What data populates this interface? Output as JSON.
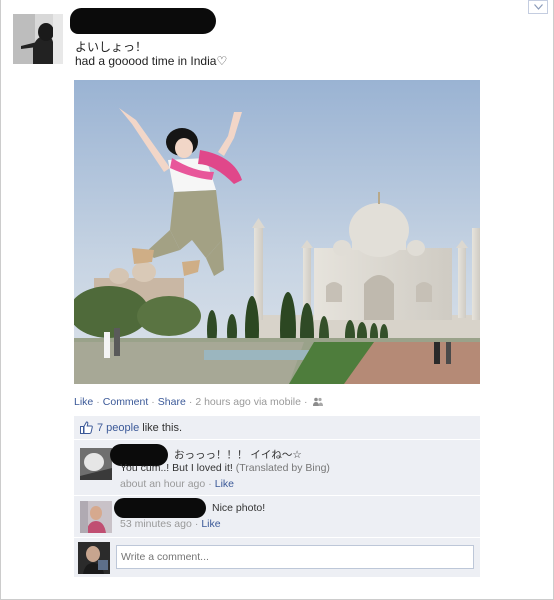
{
  "post": {
    "status_line1": "よいしょっ！",
    "status_line2": "had a gooood time in India♡"
  },
  "actions": {
    "like": "Like",
    "comment": "Comment",
    "share": "Share",
    "timestamp": "2 hours ago via mobile",
    "separator": "·"
  },
  "likes": {
    "text": "7 people",
    "suffix": " like this."
  },
  "comments": [
    {
      "line1": "おっっっ！！！ イイね～☆",
      "line2": "You cum..! But I loved it!",
      "translated": "(Translated by Bing)",
      "time": "about an hour ago",
      "like": "Like"
    },
    {
      "line1": "Nice photo!",
      "time": "53 minutes ago",
      "like": "Like"
    }
  ],
  "composer": {
    "placeholder": "Write a comment..."
  },
  "icons": {
    "chevron": "chevron-down-icon",
    "people": "people-icon",
    "thumb": "thumbs-up-icon"
  },
  "colors": {
    "link": "#3b5998",
    "ufi_bg": "#edeff4",
    "meta": "#999999",
    "redaction": "#0b0b0b"
  }
}
